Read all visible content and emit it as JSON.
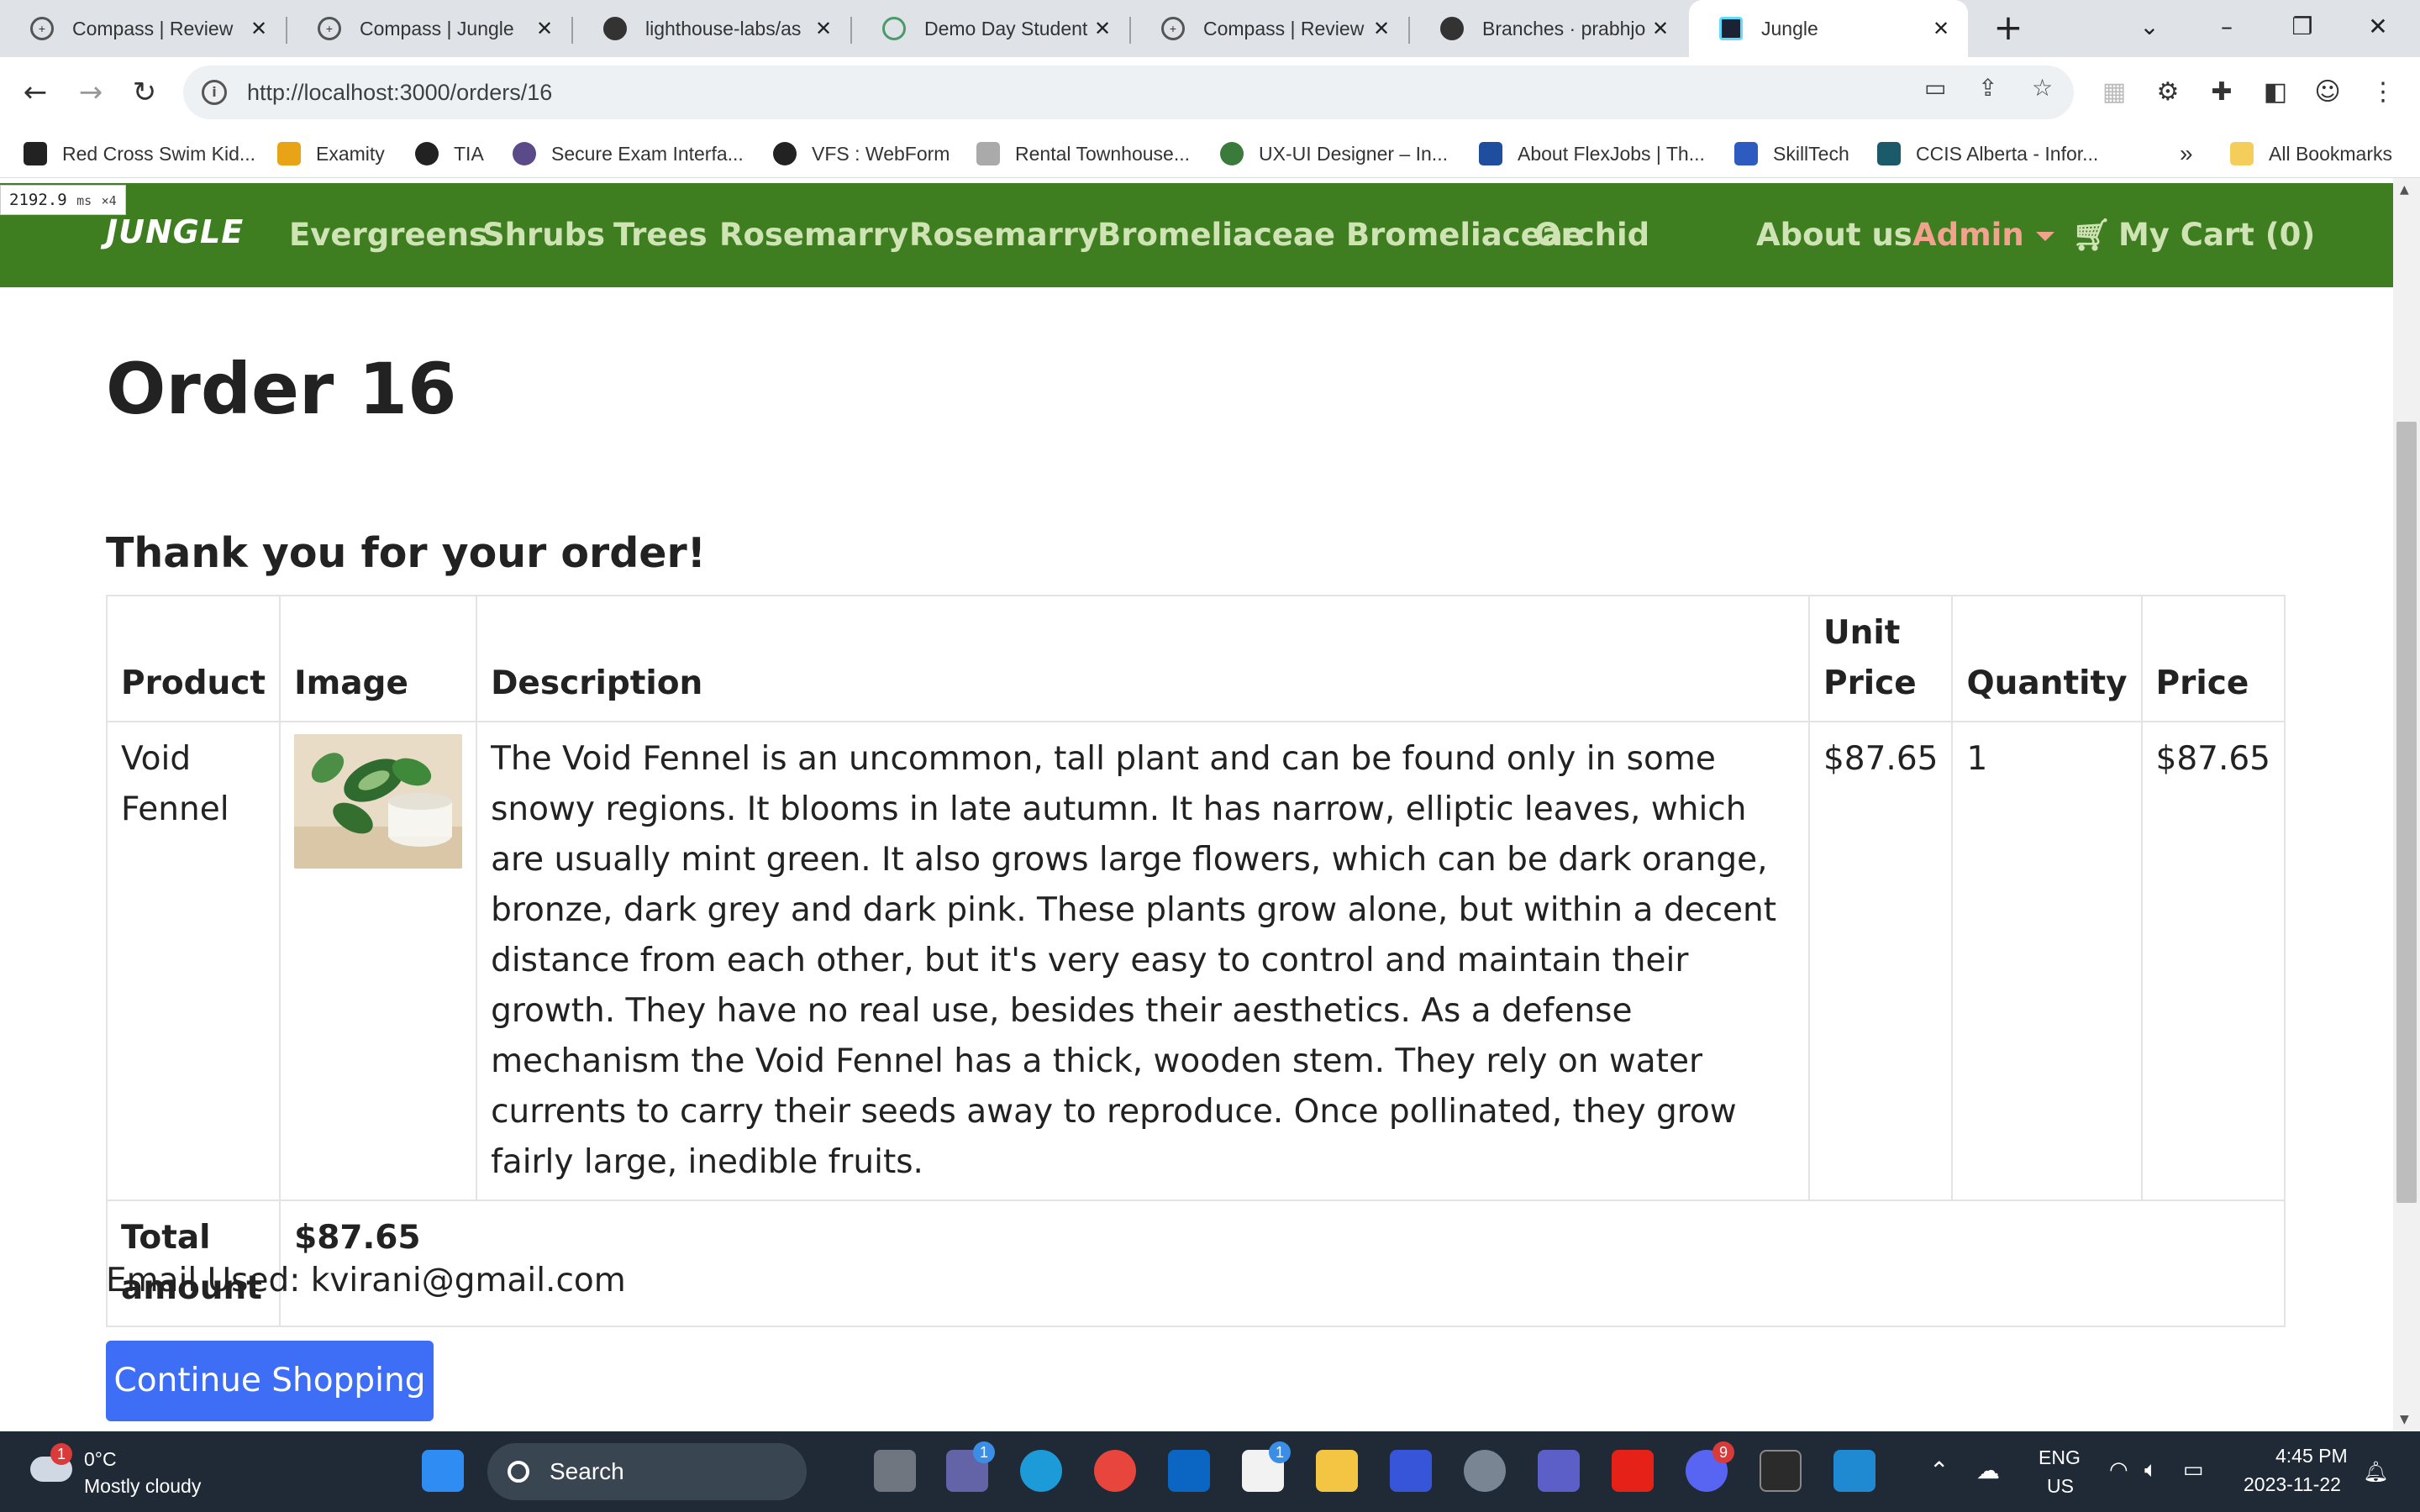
{
  "browser": {
    "tabs": [
      {
        "title": "Compass | Review"
      },
      {
        "title": "Compass | Jungle"
      },
      {
        "title": "lighthouse-labs/as"
      },
      {
        "title": "Demo Day Student"
      },
      {
        "title": "Compass | Review"
      },
      {
        "title": "Branches · prabhjo"
      },
      {
        "title": "Jungle"
      }
    ],
    "url": "http://localhost:3000/orders/16",
    "bookmarks": [
      {
        "label": "Red Cross Swim Kid...",
        "color": "#222222"
      },
      {
        "label": "Examity",
        "color": "#e8a317"
      },
      {
        "label": "TIA",
        "color": "#222222"
      },
      {
        "label": "Secure Exam Interfa...",
        "color": "#5a4a8a"
      },
      {
        "label": "VFS : WebForm",
        "color": "#222222"
      },
      {
        "label": "Rental Townhouse...",
        "color": "#888888"
      },
      {
        "label": "UX-UI Designer – In...",
        "color": "#3a7a3a"
      },
      {
        "label": "About FlexJobs | Th...",
        "color": "#1f4e9e"
      },
      {
        "label": "SkillTech",
        "color": "#2d5bbf"
      },
      {
        "label": "CCIS Alberta - Infor...",
        "color": "#1a5a6a"
      }
    ],
    "bookmarks_overflow": "»",
    "all_bookmarks": "All Bookmarks"
  },
  "perf": {
    "ms": "2192.9",
    "unit": "ms",
    "multiplier": "×4"
  },
  "site": {
    "brand": "JUNGLE",
    "nav": [
      "Evergreens",
      "Shrubs",
      "Trees",
      "Rosemarry",
      "Rosemarry",
      "Bromeliaceae Bromeliaceae",
      "Orchid"
    ],
    "about": "About us",
    "admin": "Admin",
    "cart": "My Cart (0)"
  },
  "order": {
    "title": "Order 16",
    "thanks": "Thank you for your order!",
    "headers": {
      "product": "Product",
      "image": "Image",
      "description": "Description",
      "unit_price": "Unit Price",
      "quantity": "Quantity",
      "price": "Price"
    },
    "items": [
      {
        "product": "Void Fennel",
        "description": "The Void Fennel is an uncommon, tall plant and can be found only in some snowy regions. It blooms in late autumn. It has narrow, elliptic leaves, which are usually mint green. It also grows large flowers, which can be dark orange, bronze, dark grey and dark pink. These plants grow alone, but within a decent distance from each other, but it's very easy to control and maintain their growth. They have no real use, besides their aesthetics. As a defense mechanism the Void Fennel has a thick, wooden stem. They rely on water currents to carry their seeds away to reproduce. Once pollinated, they grow fairly large, inedible fruits.",
        "unit_price": "$87.65",
        "quantity": "1",
        "price": "$87.65"
      }
    ],
    "total_label": "Total amount",
    "total": "$87.65",
    "email_line": "Email Used: kvirani@gmail.com",
    "continue_label": "Continue Shopping"
  },
  "taskbar": {
    "weather_badge": "1",
    "temperature": "0°C",
    "weather": "Mostly cloudy",
    "search_label": "Search",
    "lang_top": "ENG",
    "lang_bottom": "US",
    "time": "4:45 PM",
    "date": "2023-11-22",
    "badges": {
      "teams": "1",
      "store": "1",
      "discord": "9"
    }
  },
  "colors": {
    "nav_green": "#3e7e21",
    "nav_link": "#cfe3b4",
    "admin": "#f2a38e",
    "button": "#3d6ef5"
  }
}
